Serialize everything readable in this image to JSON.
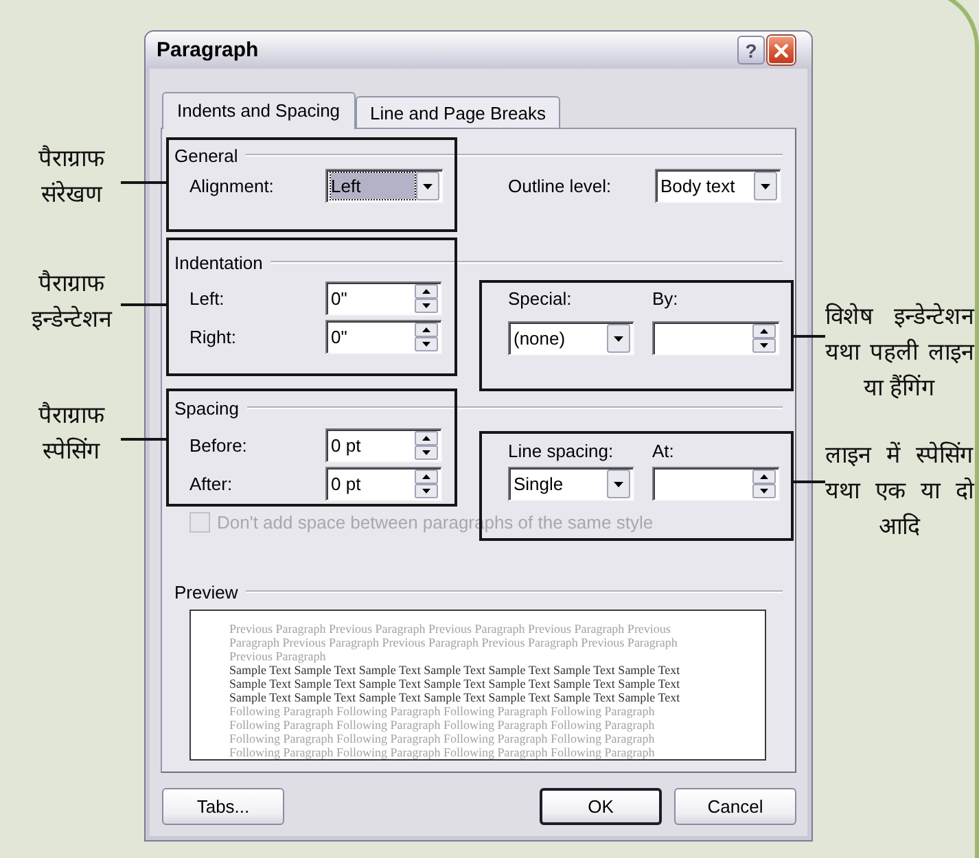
{
  "window": {
    "title": "Paragraph",
    "title_buttons": [
      {
        "kind": "help",
        "label": "?"
      },
      {
        "kind": "close"
      }
    ]
  },
  "tabs": [
    {
      "label": "Indents and Spacing",
      "selected": true
    },
    {
      "label": "Line and Page Breaks",
      "selected": false
    }
  ],
  "general": {
    "heading": "General",
    "fields": [
      {
        "kind": "dropdown",
        "label": "Alignment:",
        "value": "Left",
        "focused": true
      },
      {
        "kind": "dropdown",
        "label": "Outline level:",
        "value": "Body text",
        "focused": false
      }
    ]
  },
  "indentation": {
    "heading": "Indentation",
    "fields": [
      {
        "kind": "spin",
        "label": "Left:",
        "value": "0\""
      },
      {
        "kind": "spin",
        "label": "Right:",
        "value": "0\""
      }
    ],
    "special_indent": [
      {
        "kind": "dropdown",
        "label": "Special:",
        "value": "(none)",
        "focused": false
      },
      {
        "kind": "spin",
        "label": "By:"
      }
    ]
  },
  "spacing": {
    "heading": "Spacing",
    "fields": [
      {
        "kind": "spin",
        "label": "Before:",
        "value": "0 pt"
      },
      {
        "kind": "spin",
        "label": "After:",
        "value": "0 pt"
      }
    ],
    "line_spacing": [
      {
        "kind": "dropdown",
        "label": "Line spacing:",
        "value": "Single",
        "focused": false
      },
      {
        "kind": "spin",
        "label": "At:"
      }
    ]
  },
  "no_space_option": {
    "label": "Don't add space between paragraphs of the same style",
    "checked": false,
    "disabled": true
  },
  "preview": {
    "heading": "Preview",
    "paragraphs": [
      {
        "kind": "previous",
        "lines": [
          "Previous Paragraph Previous Paragraph Previous Paragraph Previous Paragraph Previous",
          "Paragraph Previous Paragraph Previous Paragraph Previous Paragraph Previous Paragraph",
          "Previous Paragraph"
        ]
      },
      {
        "kind": "sample",
        "lines": [
          "Sample Text Sample Text Sample Text Sample Text Sample Text Sample Text Sample Text",
          "Sample Text Sample Text Sample Text Sample Text Sample Text Sample Text Sample Text",
          "Sample Text Sample Text Sample Text Sample Text Sample Text Sample Text Sample Text"
        ]
      },
      {
        "kind": "following",
        "lines": [
          "Following Paragraph Following Paragraph Following Paragraph Following Paragraph",
          "Following Paragraph Following Paragraph Following Paragraph Following Paragraph",
          "Following Paragraph Following Paragraph Following Paragraph Following Paragraph",
          "Following Paragraph Following Paragraph Following Paragraph Following Paragraph"
        ]
      }
    ]
  },
  "buttons": [
    {
      "label": "Tabs...",
      "default": false
    },
    {
      "label": "OK",
      "default": true
    },
    {
      "label": "Cancel",
      "default": false
    }
  ],
  "annotations": [
    {
      "text": "पैराग्राफ संरेखण",
      "kind": "left"
    },
    {
      "text": "पैराग्राफ इन्डेन्टेशन",
      "kind": "left"
    },
    {
      "text": "पैराग्राफ स्पेसिंग",
      "kind": "left"
    },
    {
      "text": "विशेष इन्डेन्टेशन यथा पहली लाइन या हैंगिंग",
      "kind": "right"
    },
    {
      "text": "लाइन में स्पेसिंग यथा एक या दो आदि",
      "kind": "right"
    }
  ]
}
